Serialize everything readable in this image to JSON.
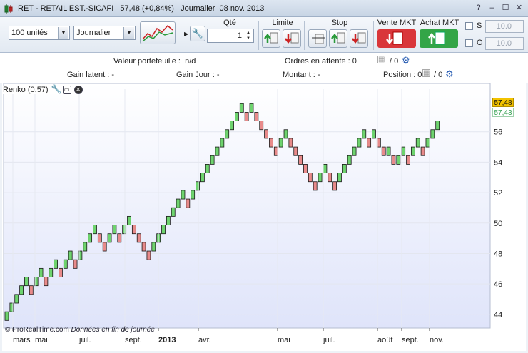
{
  "window": {
    "title": "RET - RETAIL EST.-SICAFI   57,48 (+0,84%)   Journalier  08 nov. 2013",
    "controls": [
      "help-icon",
      "minimize-icon",
      "maximize-icon",
      "close-icon"
    ]
  },
  "toolbar": {
    "quantity_select": "100 unités",
    "period_select": "Journalier",
    "qte_label": "Qté",
    "qte_value": "1",
    "limite_label": "Limite",
    "stop_label": "Stop",
    "vente_label": "Vente MKT",
    "achat_label": "Achat MKT",
    "s_label": "S",
    "o_label": "O",
    "s_value": "10.0",
    "o_value": "10.0",
    "colors": {
      "vente": "#d9363a",
      "achat": "#33a547"
    }
  },
  "info": {
    "portfolio": "Valeur portefeuille :  n/d",
    "orders": "Ordres en attente : 0",
    "orders_suffix": "/ 0",
    "gain_latent": "Gain latent : -",
    "gain_jour": "Gain Jour : -",
    "montant": "Montant : -",
    "position": "Position : 0",
    "position_suffix": "/ 0"
  },
  "chart_legend": "Renko (0,57)",
  "price_tags": {
    "last": "57,48",
    "close": "57,43"
  },
  "footer": {
    "copyright": "© ProRealTime.com",
    "note": "Données en fin de journée"
  },
  "chart_data": {
    "type": "renko",
    "box_size": 0.57,
    "y_ticks": [
      44,
      46,
      48,
      50,
      52,
      54,
      56
    ],
    "ylim": [
      43.1,
      58.8
    ],
    "x_tick_labels": [
      "mars",
      "mai",
      "juil.",
      "sept.",
      "2013",
      "avr.",
      "mai",
      "juil.",
      "août",
      "sept.",
      "nov."
    ],
    "bricks_low": [
      43.6,
      44.17,
      44.74,
      45.31,
      45.88,
      45.31,
      45.88,
      46.45,
      45.88,
      46.45,
      47.02,
      46.45,
      47.02,
      47.59,
      47.02,
      47.59,
      48.16,
      48.73,
      49.3,
      48.73,
      48.16,
      48.73,
      49.3,
      48.73,
      49.3,
      49.87,
      49.3,
      48.73,
      48.16,
      47.59,
      48.16,
      48.73,
      49.3,
      49.87,
      50.44,
      51.01,
      51.58,
      51.01,
      51.58,
      52.15,
      52.72,
      53.29,
      53.86,
      54.43,
      55.0,
      55.57,
      56.14,
      56.71,
      57.28,
      56.71,
      57.28,
      56.71,
      56.14,
      55.57,
      55.0,
      54.43,
      55.0,
      55.57,
      55.0,
      54.43,
      53.86,
      53.29,
      52.72,
      52.15,
      52.72,
      53.29,
      52.72,
      52.15,
      52.72,
      53.29,
      53.86,
      54.43,
      55.0,
      55.57,
      55.0,
      55.57,
      55.0,
      54.43,
      54.43,
      53.86,
      53.86,
      54.43,
      53.86,
      54.43,
      55.0,
      54.43,
      55.0,
      55.57,
      56.14
    ],
    "bricks_up": [
      true,
      true,
      true,
      true,
      true,
      false,
      true,
      true,
      false,
      true,
      true,
      false,
      true,
      true,
      false,
      true,
      true,
      true,
      true,
      false,
      false,
      true,
      true,
      false,
      true,
      true,
      false,
      false,
      false,
      false,
      true,
      true,
      true,
      true,
      true,
      true,
      true,
      false,
      true,
      true,
      true,
      true,
      true,
      true,
      true,
      true,
      true,
      true,
      true,
      false,
      true,
      false,
      false,
      false,
      false,
      false,
      true,
      true,
      false,
      false,
      false,
      false,
      false,
      false,
      true,
      true,
      false,
      false,
      true,
      true,
      true,
      true,
      true,
      true,
      false,
      true,
      false,
      false,
      true,
      false,
      true,
      true,
      false,
      true,
      true,
      false,
      true,
      true,
      true
    ]
  }
}
